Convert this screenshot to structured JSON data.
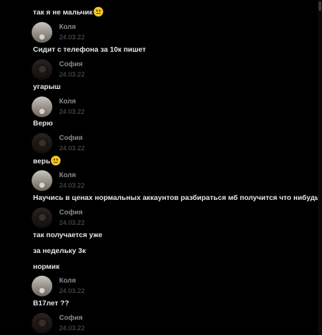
{
  "messages": [
    {
      "type": "text",
      "text": "так я не мальчик",
      "emoji": "laughing-emoji"
    },
    {
      "type": "header",
      "author": "Коля",
      "time": "24.03.22"
    },
    {
      "type": "text",
      "text": "Сидит с телефона за 10к пишет"
    },
    {
      "type": "header",
      "author": "София",
      "time": "24.03.22"
    },
    {
      "type": "text",
      "text": "угарыш"
    },
    {
      "type": "header",
      "author": "Коля",
      "time": "24.03.22"
    },
    {
      "type": "text",
      "text": "Верю"
    },
    {
      "type": "header",
      "author": "София",
      "time": "24.03.22"
    },
    {
      "type": "text",
      "text": "верь",
      "emoji": "neutral-face-emoji"
    },
    {
      "type": "header",
      "author": "Коля",
      "time": "24.03.22"
    },
    {
      "type": "text",
      "text": "Научись в ценах нормальных аккаунтов разбираться мб получится что нибудь"
    },
    {
      "type": "header",
      "author": "София",
      "time": "24.03.22"
    },
    {
      "type": "text",
      "text": "так получается уже"
    },
    {
      "type": "text",
      "text": "за недельку 3к"
    },
    {
      "type": "text",
      "text": "нормик"
    },
    {
      "type": "header",
      "author": "Коля",
      "time": "24.03.22"
    },
    {
      "type": "text",
      "text": "В17лет ??"
    },
    {
      "type": "header",
      "author": "София",
      "time": "24.03.22"
    }
  ]
}
